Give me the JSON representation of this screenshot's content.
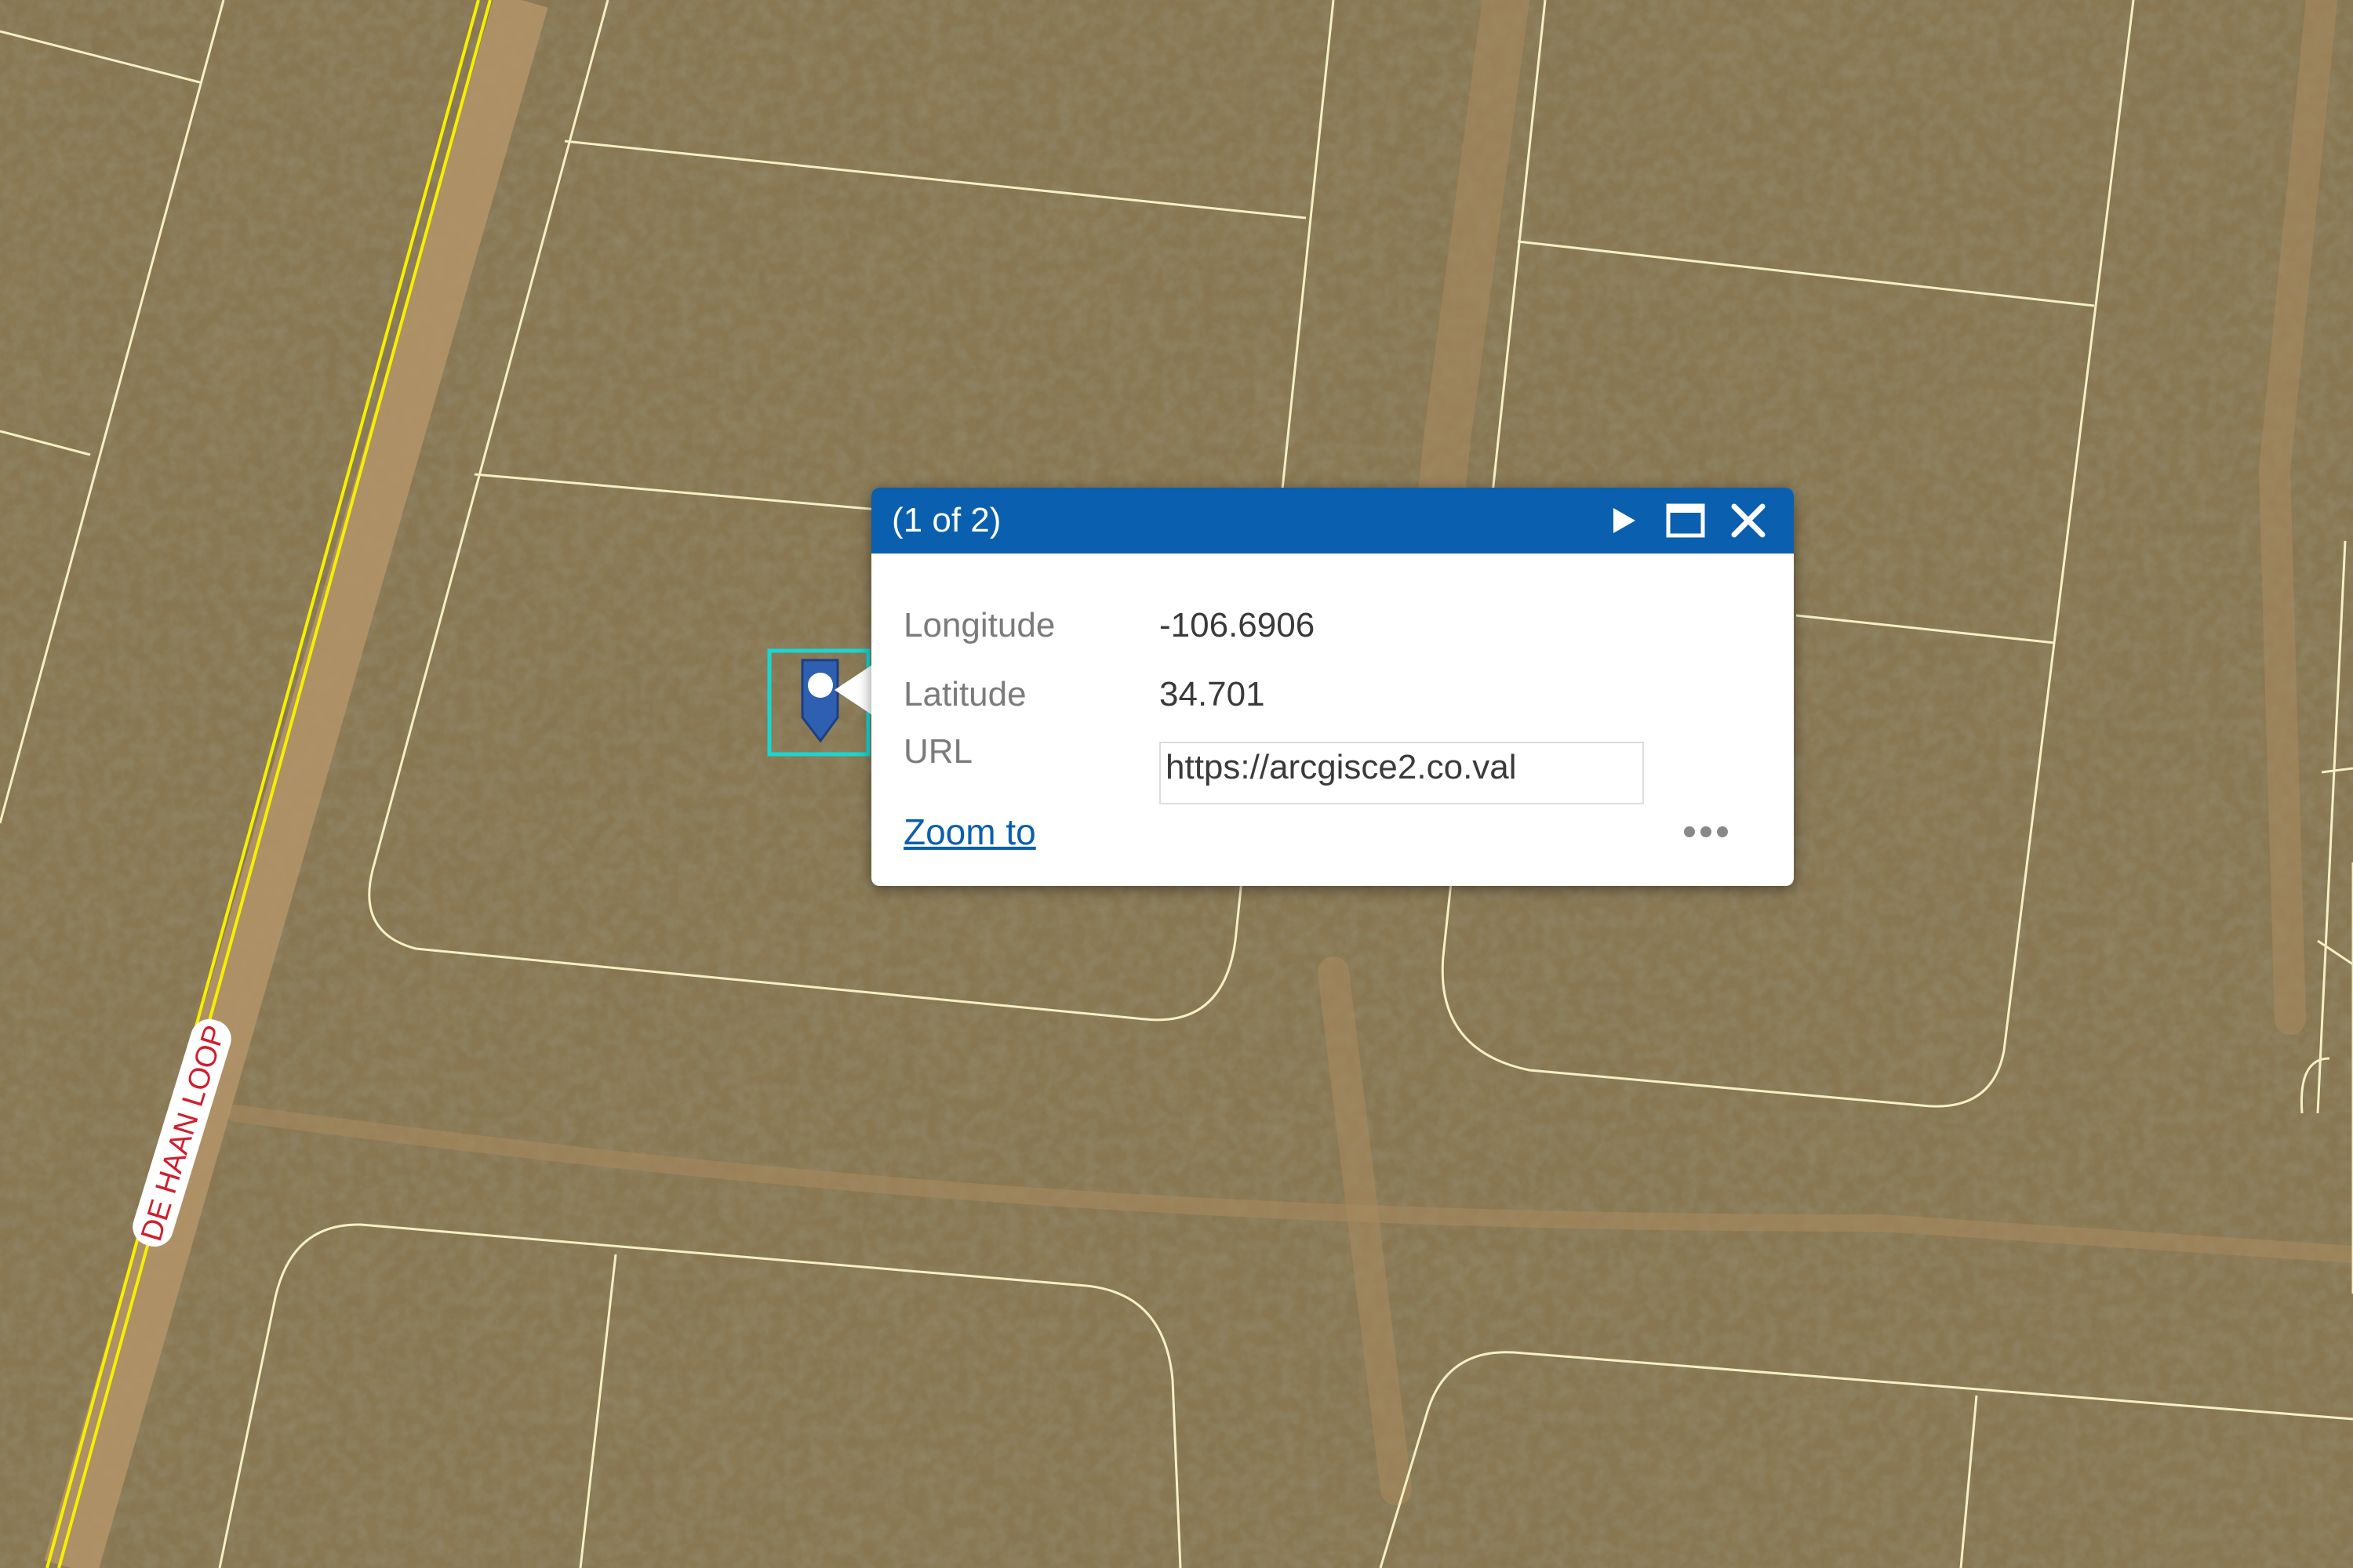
{
  "map": {
    "road_label": "DE HAAN LOOP",
    "road_label_color": "#d01e2e",
    "parcel_line_color": "#f4f0c4",
    "road_line_color": "#f5f000",
    "ground_color": "#7a6a48",
    "selection_color": "#18d7d2",
    "marker_color": "#2f5fb0"
  },
  "popup": {
    "title": "(1 of 2)",
    "header_color": "#0a5fae",
    "next_icon": "play-icon",
    "maximize_icon": "maximize-icon",
    "close_icon": "close-icon",
    "fields": [
      {
        "label": "Longitude",
        "value": "-106.6906"
      },
      {
        "label": "Latitude",
        "value": "34.701"
      },
      {
        "label": "URL",
        "value": "https://arcgisce2.co.val"
      }
    ],
    "zoom_label": "Zoom to",
    "more_icon": "ellipsis-icon"
  }
}
